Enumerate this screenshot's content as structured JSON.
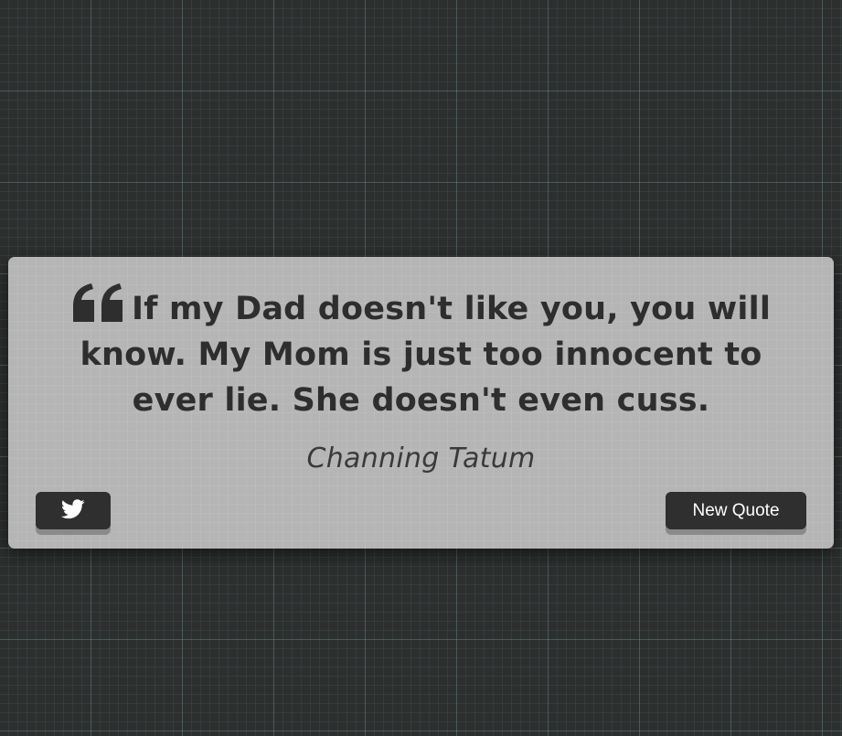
{
  "quote": {
    "text": "If my Dad doesn't like you, you will know. My Mom is just too innocent to ever lie. She doesn't even cuss.",
    "author": "Channing Tatum",
    "quote_icon": "quote-left-icon"
  },
  "actions": {
    "tweet_icon": "twitter-icon",
    "new_quote_label": "New Quote"
  },
  "colors": {
    "background": "#2d2f2f",
    "card": "#b5b5b5",
    "text": "#2e2e2e",
    "button": "#2f2f2f"
  }
}
